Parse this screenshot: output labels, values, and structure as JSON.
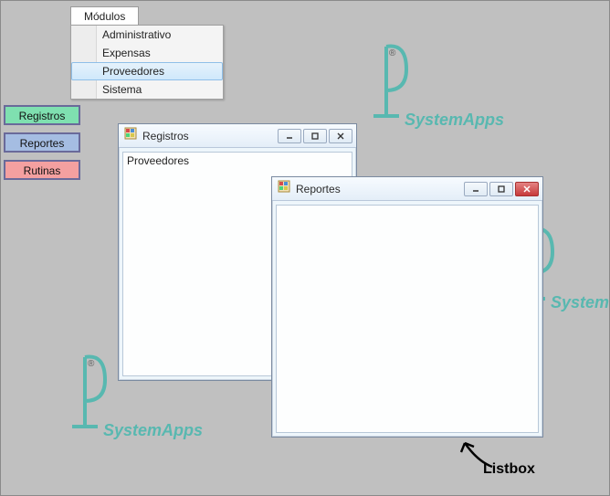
{
  "menu": {
    "tab_label": "Módulos",
    "items": [
      "Administrativo",
      "Expensas",
      "Proveedores",
      "Sistema"
    ],
    "hover_index": 2
  },
  "side_buttons": {
    "registros": "Registros",
    "reportes": "Reportes",
    "rutinas": "Rutinas"
  },
  "watermark": {
    "brand": "SystemApps",
    "reg_mark": "®"
  },
  "child_windows": {
    "registros": {
      "title": "Registros",
      "list": [
        "Proveedores"
      ]
    },
    "reportes": {
      "title": "Reportes"
    }
  },
  "annotation": {
    "label": "Listbox"
  }
}
